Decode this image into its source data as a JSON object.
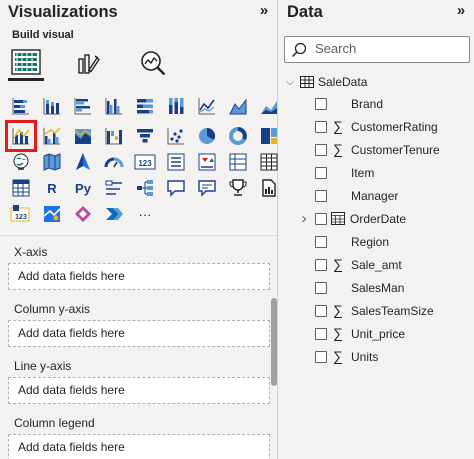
{
  "visualizations": {
    "title": "Visualizations",
    "collapse_glyph": "»",
    "build_label": "Build visual",
    "top_icons": [
      "build-visual-icon",
      "format-visual-icon",
      "analytics-icon"
    ],
    "extra_glyph": "···",
    "text_glyphs": {
      "r": "R",
      "py": "Py"
    }
  },
  "wells": [
    {
      "label": "X-axis",
      "placeholder": "Add data fields here"
    },
    {
      "label": "Column y-axis",
      "placeholder": "Add data fields here"
    },
    {
      "label": "Line y-axis",
      "placeholder": "Add data fields here"
    },
    {
      "label": "Column legend",
      "placeholder": "Add data fields here"
    }
  ],
  "data_pane": {
    "title": "Data",
    "collapse_glyph": "»",
    "search_placeholder": "Search",
    "table_name": "SaleData",
    "fields": [
      {
        "name": "Brand",
        "measure": false,
        "expandable": false
      },
      {
        "name": "CustomerRating",
        "measure": true,
        "expandable": false
      },
      {
        "name": "CustomerTenure",
        "measure": true,
        "expandable": false
      },
      {
        "name": "Item",
        "measure": false,
        "expandable": false
      },
      {
        "name": "Manager",
        "measure": false,
        "expandable": false
      },
      {
        "name": "OrderDate",
        "measure": false,
        "expandable": true
      },
      {
        "name": "Region",
        "measure": false,
        "expandable": false
      },
      {
        "name": "Sale_amt",
        "measure": true,
        "expandable": false
      },
      {
        "name": "SalesMan",
        "measure": false,
        "expandable": false
      },
      {
        "name": "SalesTeamSize",
        "measure": true,
        "expandable": false
      },
      {
        "name": "Unit_price",
        "measure": true,
        "expandable": false
      },
      {
        "name": "Units",
        "measure": true,
        "expandable": false
      }
    ]
  },
  "colors": {
    "accent": "#1a3f8a",
    "highlight": "#e21b1b",
    "teal": "#117865",
    "yellow": "#e8b21a"
  }
}
